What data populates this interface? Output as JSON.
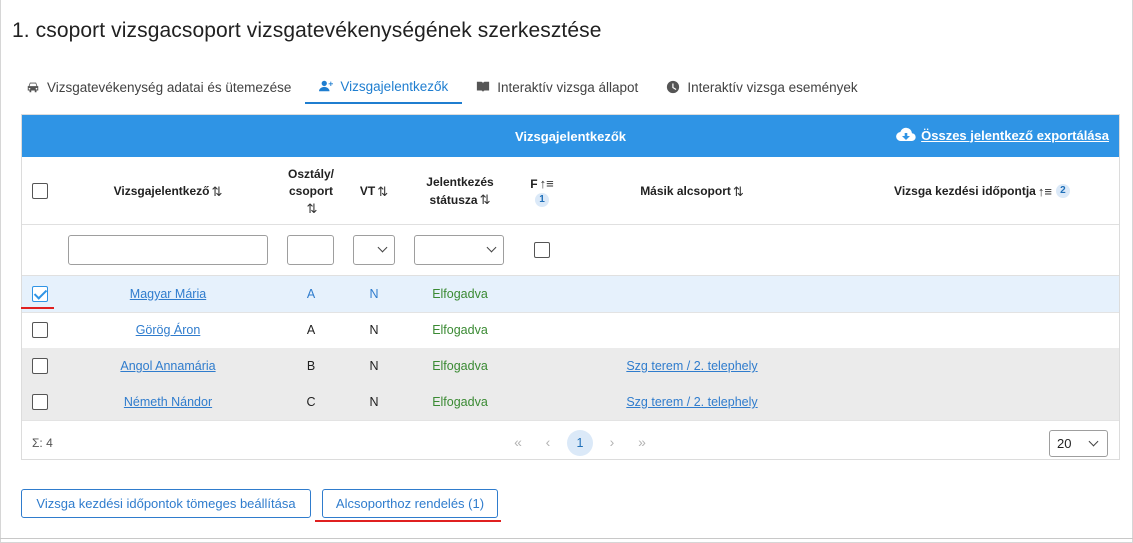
{
  "page": {
    "title": "1. csoport vizsgacsoport vizsgatevékenységének szerkesztése"
  },
  "tabs": [
    {
      "label": "Vizsgatevékenység adatai és ütemezése",
      "icon": "car-info-icon",
      "active": false
    },
    {
      "label": "Vizsgajelentkezők",
      "icon": "add-user-icon",
      "active": true
    },
    {
      "label": "Interaktív vizsga állapot",
      "icon": "book-icon",
      "active": false
    },
    {
      "label": "Interaktív vizsga események",
      "icon": "clock-icon",
      "active": false
    }
  ],
  "grid": {
    "title": "Vizsgajelentkezők",
    "export_label": "Összes jelentkező exportálása",
    "columns": {
      "name": {
        "label": "Vizsgajelentkező",
        "sort": "⇅"
      },
      "class_line1": "Osztály/",
      "class_line2": "csoport",
      "class_sort": "⇅",
      "vt": {
        "label": "VT",
        "sort": "⇅"
      },
      "status_line1": "Jelentkezés",
      "status_line2": "státusza",
      "status_sort": "⇅",
      "f": {
        "label": "F",
        "sort": "↑≡",
        "badge": "1"
      },
      "other_group": {
        "label": "Másik alcsoport",
        "sort": "⇅"
      },
      "start_time": {
        "label": "Vizsga kezdési időpontja",
        "sort": "↑≡",
        "badge": "2"
      }
    },
    "rows": [
      {
        "name": "Magyar Mária",
        "class": "A",
        "vt": "N",
        "status": "Elfogadva",
        "other_group": "",
        "checked": true
      },
      {
        "name": "Görög Áron",
        "class": "A",
        "vt": "N",
        "status": "Elfogadva",
        "other_group": "",
        "checked": false
      },
      {
        "name": "Angol Annamária",
        "class": "B",
        "vt": "N",
        "status": "Elfogadva",
        "other_group": "Szg terem / 2. telephely",
        "checked": false
      },
      {
        "name": "Németh Nándor",
        "class": "C",
        "vt": "N",
        "status": "Elfogadva",
        "other_group": "Szg terem / 2. telephely",
        "checked": false
      }
    ],
    "footer": {
      "sum_label": "Σ: 4",
      "pager": {
        "first": "«",
        "prev": "‹",
        "current": "1",
        "next": "›",
        "last": "»"
      },
      "page_size": "20"
    }
  },
  "buttons": {
    "bulk_start_time": "Vizsga kezdési időpontok tömeges beállítása",
    "assign_subgroup": "Alcsoporthoz rendelés (1)"
  },
  "colors": {
    "accent": "#2f94e5",
    "link": "#2f7ccd",
    "success": "#3a8a33",
    "marker": "#e02020"
  }
}
